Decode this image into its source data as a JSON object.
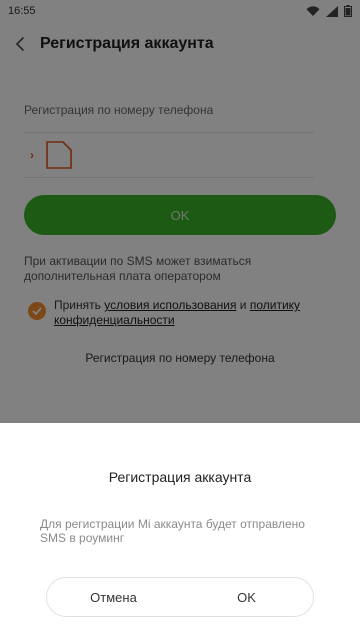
{
  "status_bar": {
    "time": "16:55"
  },
  "header": {
    "title": "Регистрация аккаунта"
  },
  "form": {
    "phone_label": "Регистрация по номеру телефона",
    "phone_value": "",
    "ok_label": "OK",
    "sms_note": "При активации по SMS может взиматься дополнительная плата оператором",
    "terms": {
      "prefix": "Принять",
      "link1": "условия использования",
      "middle": "и",
      "link2_part1": "политику",
      "link2_part2": "конфиденциальности",
      "checked": true
    },
    "alt_register": "Регистрация по номеру телефона"
  },
  "dialog": {
    "title": "Регистрация аккаунта",
    "message": "Для регистрации Mi аккаунта будет отправлено SMS в роуминг",
    "cancel_label": "Отмена",
    "ok_label": "OK"
  },
  "colors": {
    "accent_green": "#39ad27",
    "accent_orange": "#f08a2c",
    "sim_red": "#d9531e"
  },
  "icons": [
    "back-icon",
    "wifi-icon",
    "signal-icon",
    "battery-icon",
    "sim-card-icon",
    "check-icon"
  ]
}
